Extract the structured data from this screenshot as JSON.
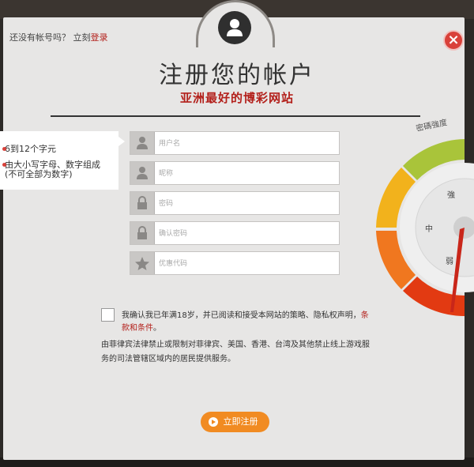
{
  "header": {
    "prompt": "还没有帐号吗？ 立刻",
    "login_label": "登录",
    "close_label": "×"
  },
  "title": "注册您的帐户",
  "subtitle": "亚洲最好的博彩网站",
  "password_hint": {
    "rule1": "6到12个字元",
    "rule2": "由大小写字母、数字组成",
    "rule2_note": "(不可全部为数字)"
  },
  "fields": [
    {
      "placeholder": "用户名",
      "icon": "user-icon"
    },
    {
      "placeholder": "昵称",
      "icon": "user-icon"
    },
    {
      "placeholder": "密码",
      "icon": "lock-icon"
    },
    {
      "placeholder": "确认密码",
      "icon": "lock-icon"
    },
    {
      "placeholder": "优惠代码",
      "icon": "star-icon"
    }
  ],
  "terms": {
    "text": "我确认我已年满18岁，并已阅读和接受本网站的策略、隐私权声明，",
    "link": "条款和条件",
    "suffix": "。"
  },
  "disclaimer": "由菲律宾法律禁止或限制对菲律宾、美国、香港、台湾及其他禁止线上游戏服务的司法管辖区域内的居民提供服务。",
  "submit_label": "立即注册",
  "strength_meter": {
    "title": "密碼強度",
    "levels": [
      "強",
      "中",
      "弱"
    ],
    "colors": {
      "strong": "#a9c43a",
      "medium": "#f2b21c",
      "weak": "#e23a12"
    }
  },
  "colors": {
    "accent": "#b3201b",
    "button": "#f18b22"
  }
}
